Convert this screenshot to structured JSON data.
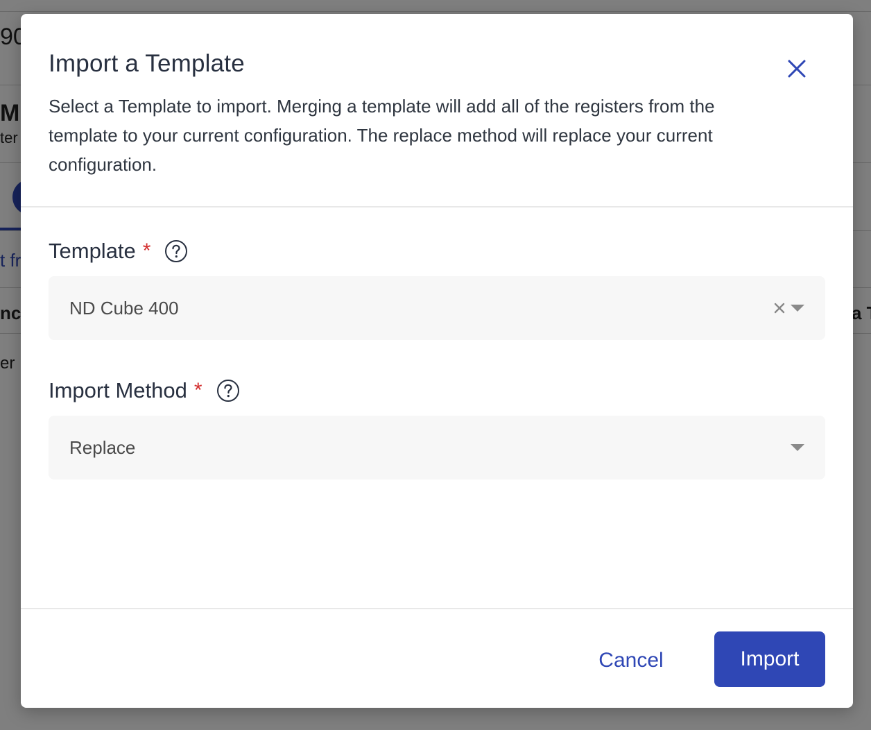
{
  "background": {
    "fragments": [
      "90",
      "M",
      "ter",
      "t fr",
      "nct",
      "er",
      "a T"
    ]
  },
  "modal": {
    "title": "Import a Template",
    "description": "Select a Template to import. Merging a template will add all of the registers from the template to your current configuration. The replace method will replace your current configuration.",
    "close_icon": "close-icon"
  },
  "template_field": {
    "label": "Template",
    "required_mark": "*",
    "help_icon": "question-circle-icon",
    "value": "ND Cube 400",
    "clear_icon": "clear-x-icon",
    "dropdown_icon": "caret-down-icon"
  },
  "import_method_field": {
    "label": "Import Method",
    "required_mark": "*",
    "help_icon": "question-circle-icon",
    "value": "Replace",
    "dropdown_icon": "caret-down-icon"
  },
  "footer": {
    "cancel_label": "Cancel",
    "import_label": "Import"
  },
  "colors": {
    "primary": "#2f47b5",
    "required": "#d32f2f",
    "title_text": "#283040",
    "select_bg": "#f7f7f7"
  }
}
